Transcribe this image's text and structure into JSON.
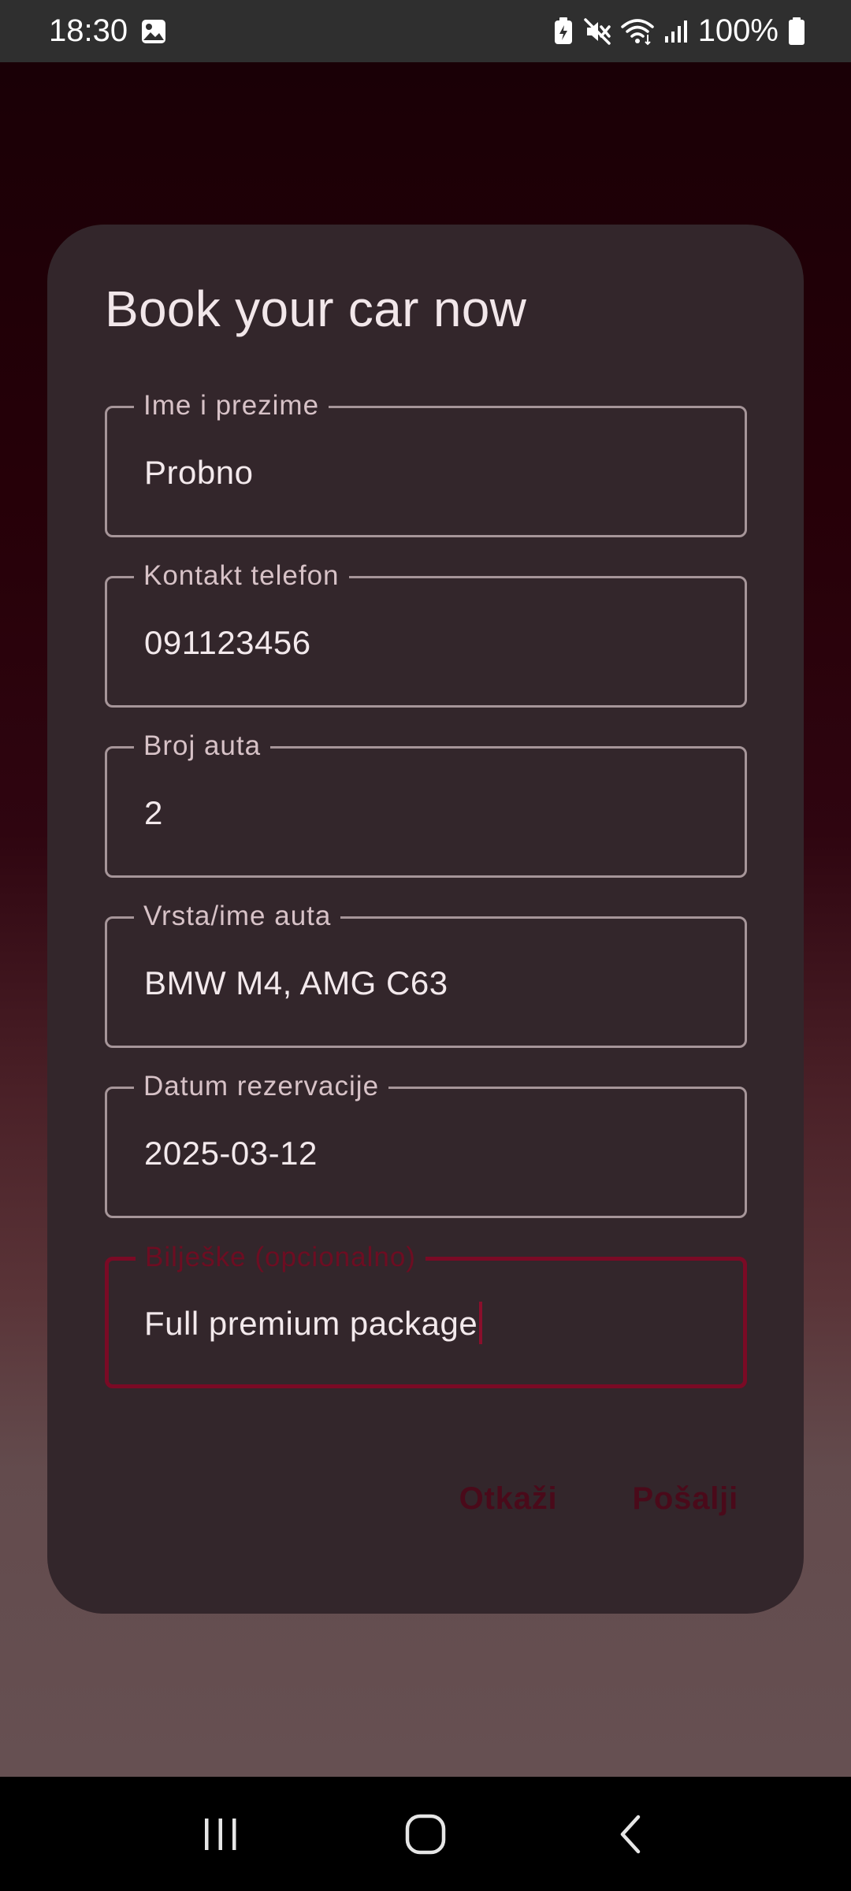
{
  "status_bar": {
    "time": "18:30",
    "battery": "100%",
    "icons": [
      "gallery-icon",
      "battery-saver-icon",
      "mute-icon",
      "wifi-icon",
      "signal-icon",
      "battery-icon"
    ]
  },
  "dialog": {
    "title": "Book your car now",
    "fields": [
      {
        "label": "Ime i prezime",
        "value": "Probno"
      },
      {
        "label": "Kontakt telefon",
        "value": "091123456"
      },
      {
        "label": "Broj auta",
        "value": "2"
      },
      {
        "label": "Vrsta/ime auta",
        "value": "BMW M4, AMG C63"
      },
      {
        "label": "Datum rezervacije",
        "value": "2025-03-12"
      },
      {
        "label": "Bilješke (opcionalno)",
        "value": "Full premium package",
        "focused": true
      }
    ],
    "cancel_label": "Otkaži",
    "submit_label": "Pošalji"
  },
  "colors": {
    "accent": "#7a0a25",
    "dialog_bg": "#33262b",
    "outline": "#a69599"
  },
  "nav_bar": {
    "buttons": [
      "recents-icon",
      "home-icon",
      "back-icon"
    ]
  }
}
